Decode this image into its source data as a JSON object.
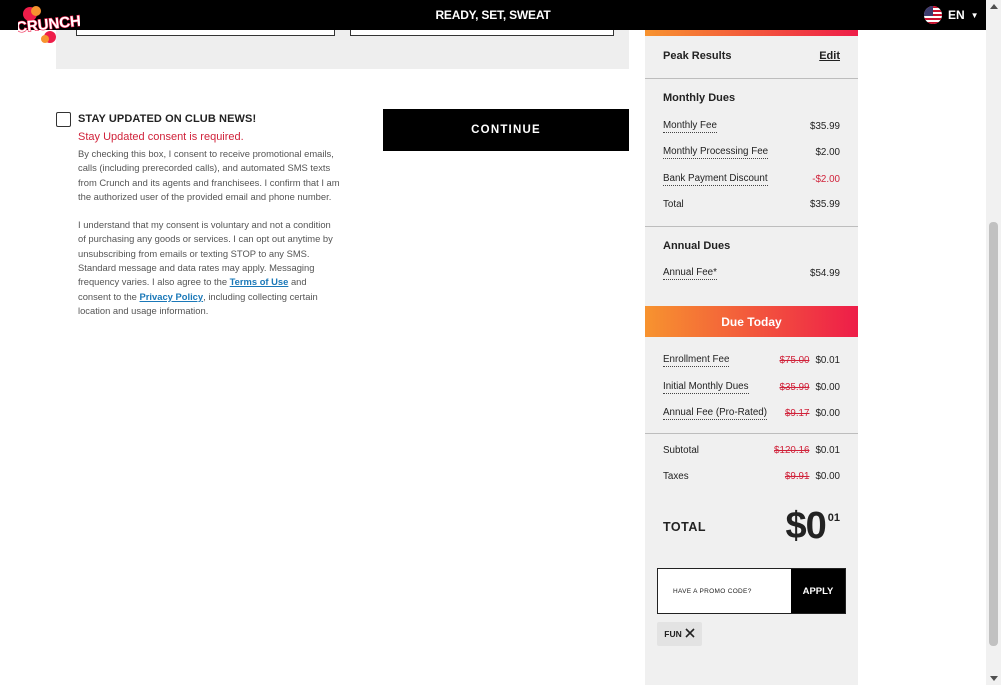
{
  "header": {
    "tagline": "READY, SET, SWEAT",
    "language": "EN"
  },
  "brand": {
    "logo_text": "CRUNCH",
    "accent_start": "#f7932f",
    "accent_end": "#ee1d49"
  },
  "consent": {
    "checkbox_label": "STAY UPDATED ON CLUB NEWS!",
    "error": "Stay Updated consent is required.",
    "paragraph1": "By checking this box, I consent to receive promotional emails, calls (including prerecorded calls), and automated SMS texts from Crunch and its agents and franchisees. I confirm that I am the authorized user of the provided email and phone number.",
    "paragraph2_before": "I understand that my consent is voluntary and not a condition of purchasing any goods or services. I can opt out anytime by unsubscribing from emails or texting STOP to any SMS. Standard message and data rates may apply. Messaging frequency varies. I also agree to the",
    "terms_link": "Terms of Use",
    "paragraph2_middle": "and consent to the",
    "privacy_link": "Privacy Policy",
    "paragraph2_after": ", including collecting certain location and usage information."
  },
  "actions": {
    "continue_label": "CONTINUE"
  },
  "summary": {
    "plan_name": "Peak Results",
    "edit_label": "Edit",
    "monthly": {
      "title": "Monthly Dues",
      "rows": [
        {
          "label": "Monthly Fee",
          "value": "$35.99"
        },
        {
          "label": "Monthly Processing Fee",
          "value": "$2.00"
        },
        {
          "label": "Bank Payment Discount",
          "value": "-$2.00"
        },
        {
          "label": "Total",
          "value": "$35.99"
        }
      ]
    },
    "annual": {
      "title": "Annual Dues",
      "rows": [
        {
          "label": "Annual Fee*",
          "value": "$54.99"
        }
      ]
    },
    "due_today": {
      "title": "Due Today",
      "rows": [
        {
          "label": "Enrollment Fee",
          "old": "$75.00",
          "value": "$0.01"
        },
        {
          "label": "Initial Monthly Dues",
          "old": "$35.99",
          "value": "$0.00"
        },
        {
          "label": "Annual Fee (Pro-Rated)",
          "old": "$9.17",
          "value": "$0.00"
        }
      ],
      "subtotal_label": "Subtotal",
      "subtotal_old": "$120.16",
      "subtotal_value": "$0.01",
      "taxes_label": "Taxes",
      "taxes_old": "$9.91",
      "taxes_value": "$0.00"
    },
    "total_label": "TOTAL",
    "total_main": "$0",
    "total_cents": "01",
    "promo_placeholder": "HAVE A PROMO CODE?",
    "apply_label": "APPLY",
    "applied_code": "FUN"
  }
}
